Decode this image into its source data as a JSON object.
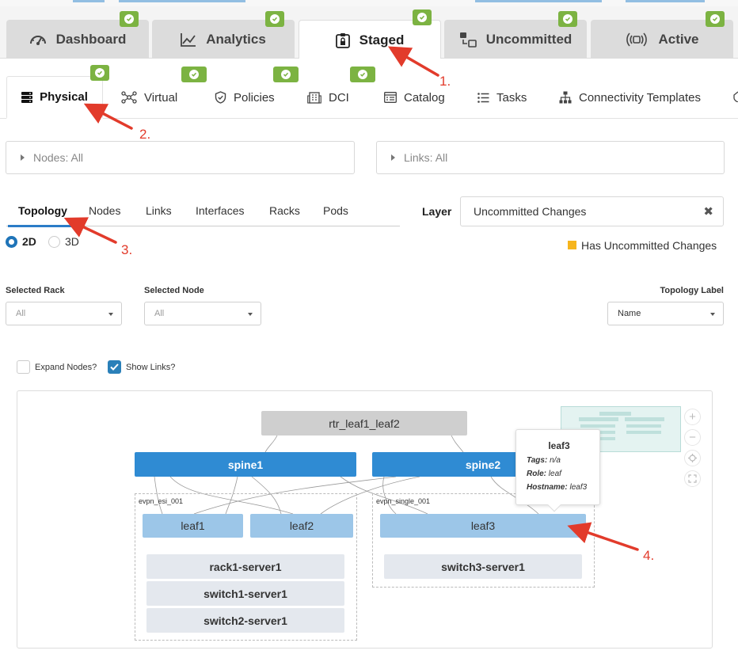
{
  "main_tabs": [
    {
      "label": "Dashboard",
      "icon": "gauge-icon"
    },
    {
      "label": "Analytics",
      "icon": "line-chart-icon"
    },
    {
      "label": "Staged",
      "icon": "clipboard-lock-icon",
      "active": true
    },
    {
      "label": "Uncommitted",
      "icon": "diff-icon"
    },
    {
      "label": "Active",
      "icon": "broadcast-icon"
    }
  ],
  "sub_tabs": [
    {
      "label": "Physical",
      "icon": "server-icon",
      "active": true
    },
    {
      "label": "Virtual",
      "icon": "network-icon"
    },
    {
      "label": "Policies",
      "icon": "shield-icon"
    },
    {
      "label": "DCI",
      "icon": "building-icon"
    },
    {
      "label": "Catalog",
      "icon": "catalog-icon"
    },
    {
      "label": "Tasks",
      "icon": "list-icon"
    },
    {
      "label": "Connectivity Templates",
      "icon": "hierarchy-icon"
    }
  ],
  "filters": {
    "nodes": "Nodes: All",
    "links": "Links: All"
  },
  "inner_tabs": [
    "Topology",
    "Nodes",
    "Links",
    "Interfaces",
    "Racks",
    "Pods"
  ],
  "view_mode": {
    "options": [
      "2D",
      "3D"
    ],
    "selected": "2D"
  },
  "layer": {
    "label": "Layer",
    "value": "Uncommitted Changes"
  },
  "legend": {
    "label": "Has Uncommitted Changes",
    "color": "#f6b51d"
  },
  "selectors": {
    "rack": {
      "label": "Selected Rack",
      "value": "All"
    },
    "node": {
      "label": "Selected Node",
      "value": "All"
    },
    "topology_label": {
      "label": "Topology Label",
      "value": "Name"
    }
  },
  "checkboxes": {
    "expand_nodes": {
      "label": "Expand Nodes?",
      "checked": false
    },
    "show_links": {
      "label": "Show Links?",
      "checked": true
    }
  },
  "topology": {
    "external": "rtr_leaf1_leaf2",
    "spines": [
      "spine1",
      "spine2"
    ],
    "racks": [
      {
        "name": "evpn_esi_001",
        "leafs": [
          "leaf1",
          "leaf2"
        ],
        "servers": [
          "rack1-server1",
          "switch1-server1",
          "switch2-server1"
        ]
      },
      {
        "name": "evpn_single_001",
        "leafs": [
          "leaf3"
        ],
        "servers": [
          "switch3-server1"
        ]
      }
    ]
  },
  "tooltip": {
    "title": "leaf3",
    "rows": [
      {
        "key": "Tags:",
        "value": "n/a"
      },
      {
        "key": "Role:",
        "value": "leaf"
      },
      {
        "key": "Hostname:",
        "value": "leaf3"
      }
    ]
  },
  "annotations": [
    "1.",
    "2.",
    "3.",
    "4."
  ],
  "colors": {
    "accent": "#2f8bd3",
    "badge": "#7cb342",
    "arrow": "#e23b2b"
  }
}
